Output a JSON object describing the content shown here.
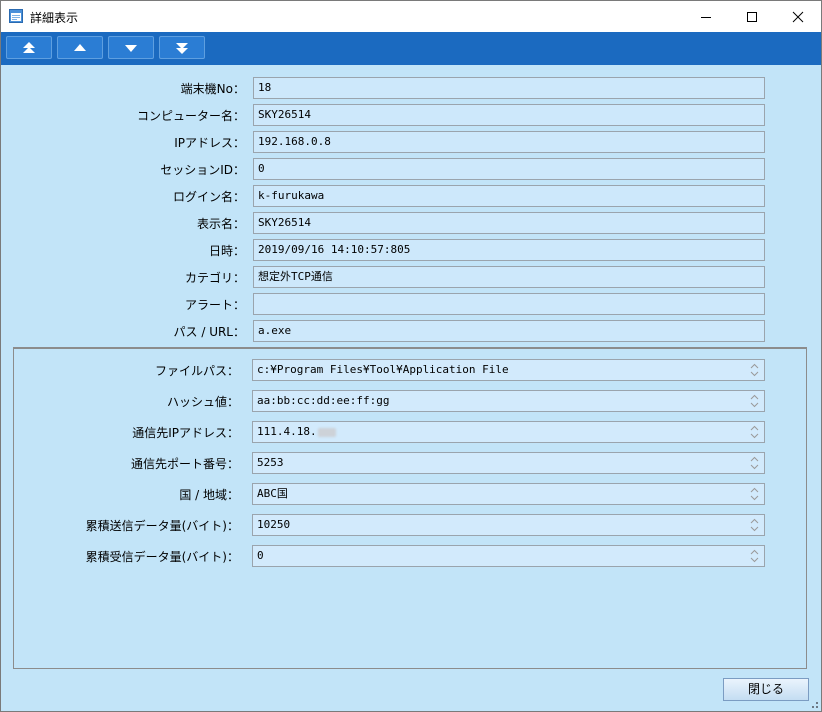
{
  "window": {
    "title": "詳細表示",
    "controls": [
      "minimize",
      "maximize",
      "close"
    ]
  },
  "toolbar": {
    "buttons": [
      {
        "name": "first-record-button",
        "icon": "double-up-arrow-icon"
      },
      {
        "name": "previous-record-button",
        "icon": "up-arrow-icon"
      },
      {
        "name": "next-record-button",
        "icon": "down-arrow-icon"
      },
      {
        "name": "last-record-button",
        "icon": "double-down-arrow-icon"
      }
    ]
  },
  "details": {
    "terminal_no": {
      "label": "端末機No：",
      "value": "18"
    },
    "computer_name": {
      "label": "コンピューター名：",
      "value": "SKY26514"
    },
    "ip_address": {
      "label": "IPアドレス：",
      "value": "192.168.0.8"
    },
    "session_id": {
      "label": "セッションID：",
      "value": "0"
    },
    "login_name": {
      "label": "ログイン名：",
      "value": "k-furukawa"
    },
    "display_name": {
      "label": "表示名：",
      "value": "SKY26514"
    },
    "datetime": {
      "label": "日時：",
      "value": "2019/09/16 14:10:57:805"
    },
    "category": {
      "label": "カテゴリ：",
      "value": "想定外TCP通信"
    },
    "alert": {
      "label": "アラート：",
      "value": ""
    },
    "path_url": {
      "label": "パス / URL：",
      "value": "a.exe"
    }
  },
  "extra": {
    "file_path": {
      "label": "ファイルパス：",
      "value": "c:¥Program Files¥Tool¥Application File"
    },
    "hash": {
      "label": "ハッシュ値：",
      "value": "aa:bb:cc:dd:ee:ff:gg"
    },
    "dest_ip": {
      "label": "通信先IPアドレス：",
      "value": "111.4.18."
    },
    "dest_port": {
      "label": "通信先ポート番号：",
      "value": "5253"
    },
    "country": {
      "label": "国 / 地域：",
      "value": "ABC国"
    },
    "sent_bytes": {
      "label": "累積送信データ量(バイト)：",
      "value": "10250"
    },
    "recv_bytes": {
      "label": "累積受信データ量(バイト)：",
      "value": "0"
    }
  },
  "footer": {
    "close_label": "閉じる"
  },
  "colors": {
    "background": "#c2e4f8",
    "toolbar": "#1b6ac0",
    "field": "#cde8fb"
  }
}
